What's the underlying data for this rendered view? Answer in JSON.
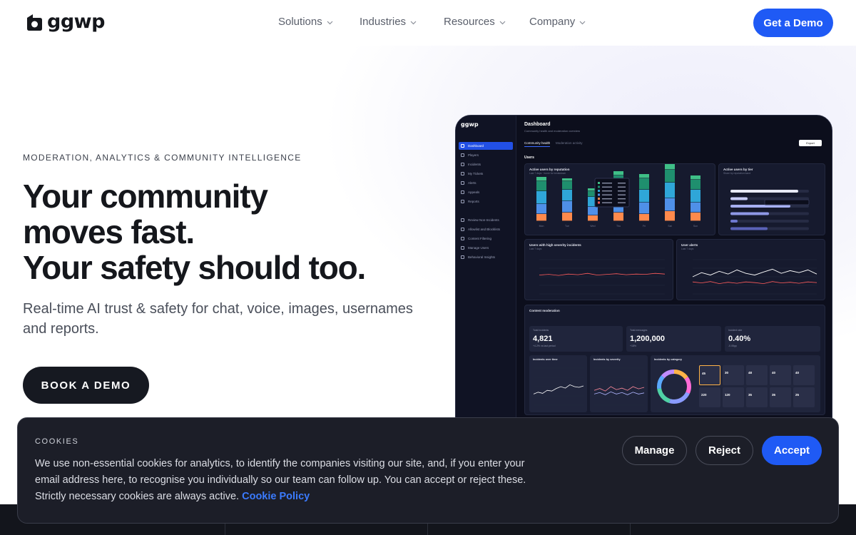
{
  "header": {
    "logo_text": "ggwp",
    "nav": [
      {
        "label": "Solutions"
      },
      {
        "label": "Industries"
      },
      {
        "label": "Resources"
      },
      {
        "label": "Company"
      }
    ],
    "cta_label": "Get a Demo",
    "accent_color": "#1f5af5"
  },
  "hero": {
    "eyebrow": "MODERATION, ANALYTICS & COMMUNITY INTELLIGENCE",
    "headline": [
      "Your community",
      "moves fast.",
      "Your safety should too."
    ],
    "subhead": "Real-time AI trust & safety for chat, voice, images, usernames and reports.",
    "cta_label": "BOOK A DEMO"
  },
  "dashboard": {
    "logo_text": "ggwp",
    "title": "Dashboard",
    "subtitle": "Community health and moderation overview",
    "tabs": [
      "Community health",
      "Moderation activity"
    ],
    "export_label": "Export",
    "sidebar": [
      "Dashboard",
      "Players",
      "Incidents",
      "My Tickets",
      "Alerts",
      "Appeals",
      "Reports",
      "Review Non-Incidents",
      "Allowlist and Blocklists",
      "Content Filtering",
      "Manage Users",
      "Behavioral Insights"
    ],
    "users_label": "Users",
    "cards": {
      "region": {
        "title": "Active users by reputation",
        "sub": "Last 7 days · hover for breakdown",
        "days": [
          "Mon",
          "Tue",
          "Wed",
          "Thu",
          "Fri",
          "Sat",
          "Sun"
        ]
      },
      "tier": {
        "title": "Active users by tier",
        "sub": "Share by reputation band"
      },
      "high": {
        "title": "Users with high severity incidents",
        "sub": "Last 7 days"
      },
      "alerts": {
        "title": "User alerts",
        "sub": "Last 7 days"
      },
      "mod": {
        "title": "Content moderation"
      },
      "stats": [
        {
          "label": "Total incidents",
          "value": "4,821",
          "delta": "+4.2% vs last period"
        },
        {
          "label": "Total messages",
          "value": "1,200,000",
          "delta": "+18%"
        },
        {
          "label": "Incident rate",
          "value": "0.40%",
          "delta": "-0.05pp"
        }
      ],
      "over_time": {
        "title": "Incidents over time"
      },
      "severity": {
        "title": "Incidents by severity"
      },
      "category": {
        "title": "Incidents by category",
        "tiles": [
          "45",
          "30",
          "48",
          "40",
          "40",
          "220",
          "120",
          "35",
          "35",
          "25"
        ]
      }
    }
  },
  "cookies": {
    "title": "COOKIES",
    "text": "We use non-essential cookies for analytics, to identify the companies visiting our site, and, if you enter your email address here, to recognise you individually so our team can follow up. You can accept or reject these. Strictly necessary cookies are always active.",
    "link": "Cookie Policy",
    "manage": "Manage",
    "reject": "Reject",
    "accept": "Accept"
  }
}
